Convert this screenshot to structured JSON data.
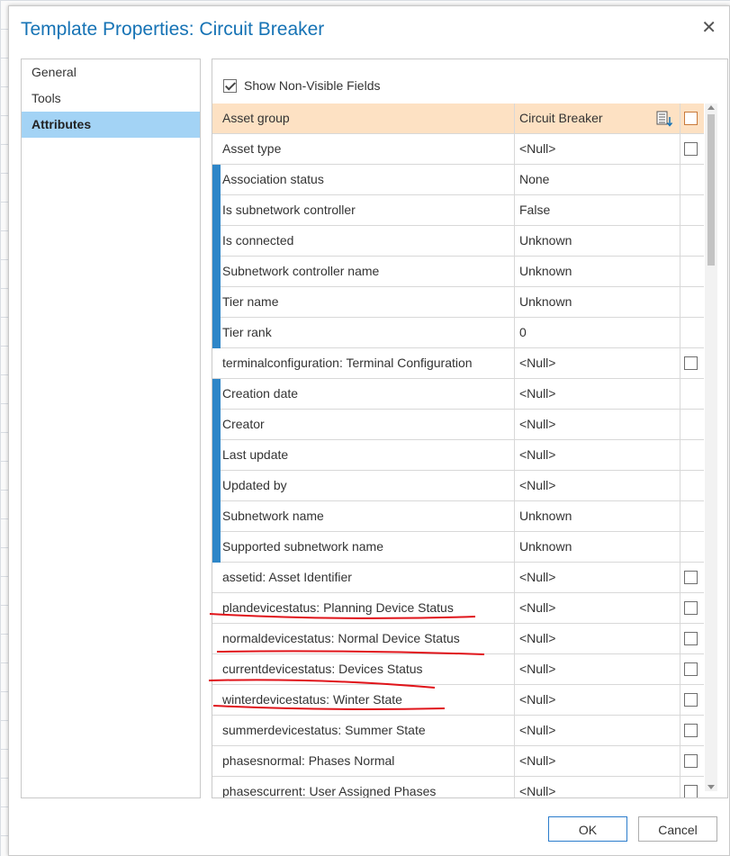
{
  "dialog": {
    "title": "Template Properties: Circuit Breaker",
    "close_glyph": "✕"
  },
  "nav": {
    "items": [
      {
        "label": "General",
        "active": false
      },
      {
        "label": "Tools",
        "active": false
      },
      {
        "label": "Attributes",
        "active": true
      }
    ]
  },
  "panel": {
    "show_non_visible_label": "Show Non-Visible Fields",
    "show_non_visible_checked": true
  },
  "grid": {
    "rows": [
      {
        "name": "Asset group",
        "value": "Circuit Breaker",
        "header": true
      },
      {
        "name": "Asset type",
        "value": "<Null>"
      },
      {
        "name": "Association status",
        "value": "None"
      },
      {
        "name": "Is subnetwork controller",
        "value": "False"
      },
      {
        "name": "Is connected",
        "value": "Unknown"
      },
      {
        "name": "Subnetwork controller name",
        "value": "Unknown"
      },
      {
        "name": "Tier name",
        "value": "Unknown"
      },
      {
        "name": "Tier rank",
        "value": "0"
      },
      {
        "name": "terminalconfiguration: Terminal Configuration",
        "value": "<Null>"
      },
      {
        "name": "Creation date",
        "value": "<Null>"
      },
      {
        "name": "Creator",
        "value": "<Null>"
      },
      {
        "name": "Last update",
        "value": "<Null>"
      },
      {
        "name": "Updated by",
        "value": "<Null>"
      },
      {
        "name": "Subnetwork name",
        "value": "Unknown"
      },
      {
        "name": "Supported subnetwork name",
        "value": "Unknown"
      },
      {
        "name": "assetid: Asset Identifier",
        "value": "<Null>"
      },
      {
        "name": "plandevicestatus: Planning Device Status",
        "value": "<Null>"
      },
      {
        "name": "normaldevicestatus: Normal Device Status",
        "value": "<Null>"
      },
      {
        "name": "currentdevicestatus: Devices Status",
        "value": "<Null>"
      },
      {
        "name": "winterdevicestatus: Winter State",
        "value": "<Null>"
      },
      {
        "name": "summerdevicestatus: Summer State",
        "value": "<Null>"
      },
      {
        "name": "phasesnormal: Phases Normal",
        "value": "<Null>"
      },
      {
        "name": "phasescurrent: User Assigned Phases",
        "value": "<Null>"
      }
    ]
  },
  "buttons": {
    "ok_label": "OK",
    "cancel_label": "Cancel"
  },
  "colors": {
    "accent": "#1673b5",
    "selection": "#a3d3f5",
    "header_row": "#fde1c3",
    "marker": "#2e86c8",
    "annotation": "#e0141a"
  }
}
